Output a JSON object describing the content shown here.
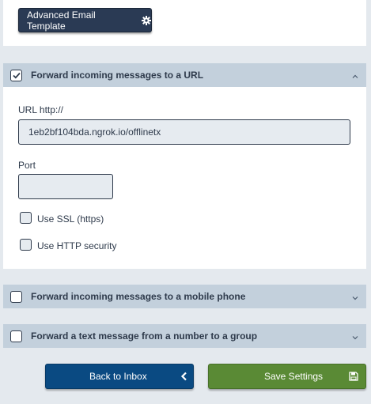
{
  "top": {
    "advanced_template_button": "Advanced Email Template",
    "advanced_template_icon": "gear-icon"
  },
  "sections": [
    {
      "title": "Forward incoming messages to a URL",
      "checked": true,
      "expanded": true,
      "url_label": "URL http://",
      "url_value": "1eb2bf104bda.ngrok.io/offlinetx",
      "port_label": "Port",
      "port_value": "",
      "use_ssl_label": "Use SSL (https)",
      "use_ssl_checked": false,
      "use_http_security_label": "Use HTTP security",
      "use_http_security_checked": false
    },
    {
      "title": "Forward incoming messages to a mobile phone",
      "checked": false,
      "expanded": false
    },
    {
      "title": "Forward a text message from a number to a group",
      "checked": false,
      "expanded": false
    }
  ],
  "footer": {
    "back_label": "Back to Inbox",
    "back_icon": "chevron-left-icon",
    "save_label": "Save Settings",
    "save_icon": "floppy-disk-icon"
  },
  "colors": {
    "page_background": "#e4e9ee",
    "section_header": "#c3d0dc",
    "dark_button": "#2a3a54",
    "blue_button": "#0a4a82",
    "green_button": "#5a8a35"
  }
}
